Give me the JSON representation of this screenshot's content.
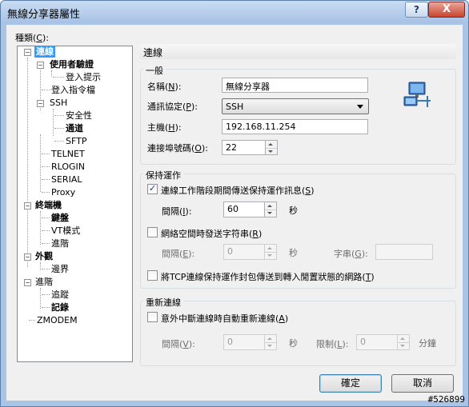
{
  "window": {
    "title": "無線分享器屬性",
    "help_glyph": "?",
    "close_glyph": "X"
  },
  "category_label": {
    "text": "種類",
    "accel": "C",
    "suffix": ":"
  },
  "tree": [
    {
      "label": "連線",
      "selected": true
    },
    {
      "label": "使用者驗證",
      "bold": true
    },
    {
      "label": "登入提示"
    },
    {
      "label": "登入指令檔"
    },
    {
      "label": "SSH"
    },
    {
      "label": "安全性"
    },
    {
      "label": "通道",
      "bold": true
    },
    {
      "label": "SFTP"
    },
    {
      "label": "TELNET"
    },
    {
      "label": "RLOGIN"
    },
    {
      "label": "SERIAL"
    },
    {
      "label": "Proxy"
    },
    {
      "label": "終端機",
      "bold": true
    },
    {
      "label": "鍵盤",
      "bold": true
    },
    {
      "label": "VT模式"
    },
    {
      "label": "進階"
    },
    {
      "label": "外觀",
      "bold": true
    },
    {
      "label": "邊界"
    },
    {
      "label": "進階"
    },
    {
      "label": "追蹤"
    },
    {
      "label": "記錄",
      "bold": true
    },
    {
      "label": "ZMODEM"
    }
  ],
  "panel_header": "連線",
  "general": {
    "title": "一般",
    "name_label": {
      "text": "名稱",
      "accel": "N",
      "suffix": ":"
    },
    "name_value": "無線分享器",
    "protocol_label": {
      "text": "通訊協定",
      "accel": "P",
      "suffix": ":"
    },
    "protocol_value": "SSH",
    "host_label": {
      "text": "主機",
      "accel": "H",
      "suffix": ":"
    },
    "host_value": "192.168.11.254",
    "port_label": {
      "text": "連接埠號碼",
      "accel": "O",
      "suffix": ":"
    },
    "port_value": "22"
  },
  "keepalive": {
    "title": "保持運作",
    "send_keepalive": {
      "text": "連線工作階段期間傳送保持運作訊息",
      "accel": "S",
      "checked": true
    },
    "interval1_label": {
      "text": "間隔",
      "accel": "I",
      "suffix": ":"
    },
    "interval1_value": "60",
    "interval1_unit": "秒",
    "send_string": {
      "text": "網絡空間時發送字符串",
      "accel": "R",
      "checked": false
    },
    "interval2_label": {
      "text": "間隔",
      "accel": "E",
      "suffix": ":"
    },
    "interval2_value": "0",
    "interval2_unit": "秒",
    "string_label": {
      "text": "字串",
      "accel": "G",
      "suffix": ":"
    },
    "string_value": "",
    "tcp_keepalive": {
      "text": "將TCP連線保持運作封包傳送到轉入閒置狀態的網路",
      "accel": "T",
      "checked": false
    }
  },
  "reconnect": {
    "title": "重新連線",
    "auto_reconnect": {
      "text": "意外中斷連線時自動重新連線",
      "accel": "A",
      "checked": false
    },
    "interval_label": {
      "text": "間隔",
      "accel": "V",
      "suffix": ":"
    },
    "interval_value": "0",
    "interval_unit": "秒",
    "limit_label": {
      "text": "限制",
      "accel": "L",
      "suffix": ":"
    },
    "limit_value": "0",
    "limit_unit": "分鐘"
  },
  "buttons": {
    "ok": "確定",
    "cancel": "取消"
  },
  "watermark": "#526899",
  "colors": {
    "selection": "#3399ff",
    "titlebar": "#a7c2e6",
    "close_button": "#c7452f"
  }
}
